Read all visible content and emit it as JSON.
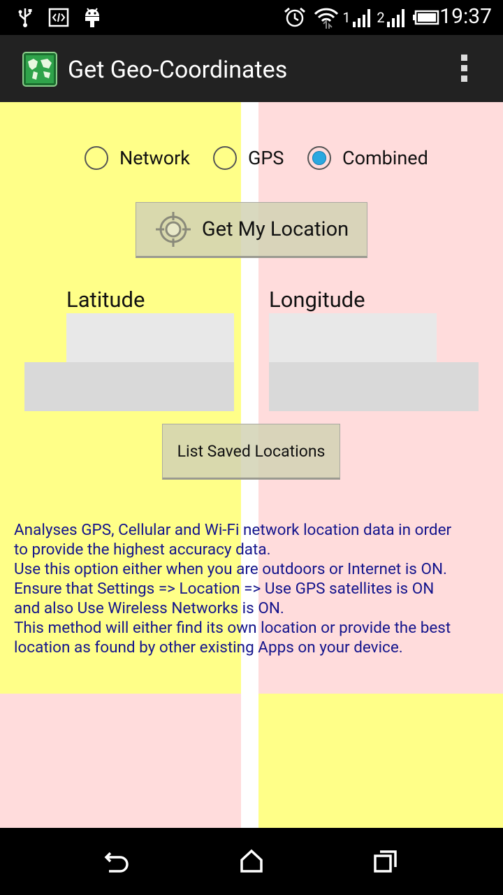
{
  "status_bar": {
    "time": "19:37",
    "icons": [
      "usb-icon",
      "developer-code-icon",
      "android-icon",
      "alarm-icon",
      "wifi-icon",
      "signal-1-icon",
      "signal-2-icon",
      "battery-icon"
    ],
    "signal_labels": [
      "1",
      "2"
    ]
  },
  "app_bar": {
    "title": "Get Geo-Coordinates",
    "app_icon": "world-map-icon",
    "overflow_icon": "overflow-menu-icon"
  },
  "location_mode": {
    "options": [
      "Network",
      "GPS",
      "Combined"
    ],
    "selected": "Combined"
  },
  "get_location_button": {
    "label": "Get My Location",
    "icon": "crosshair-target-icon"
  },
  "latitude": {
    "label": "Latitude",
    "value": ""
  },
  "longitude": {
    "label": "Longitude",
    "value": ""
  },
  "list_saved_button": {
    "label": "List Saved Locations"
  },
  "help_lines": [
    "Analyses GPS, Cellular and Wi-Fi network location data in order",
    "to provide the highest accuracy data.",
    "Use this option either when you are outdoors or Internet is ON.",
    "Ensure that Settings => Location => Use GPS satellites is ON",
    "and also Use Wireless Networks is ON.",
    "This method will either find its own location or provide the best",
    "location as found by other existing Apps on your device."
  ],
  "colors": {
    "yellow": "#ffff88",
    "pink": "#ffdcdc",
    "help_text": "#14148c",
    "radio_selected": "#29a8e0"
  },
  "nav_bar": {
    "icons": [
      "back-icon",
      "home-icon",
      "recents-icon"
    ]
  }
}
